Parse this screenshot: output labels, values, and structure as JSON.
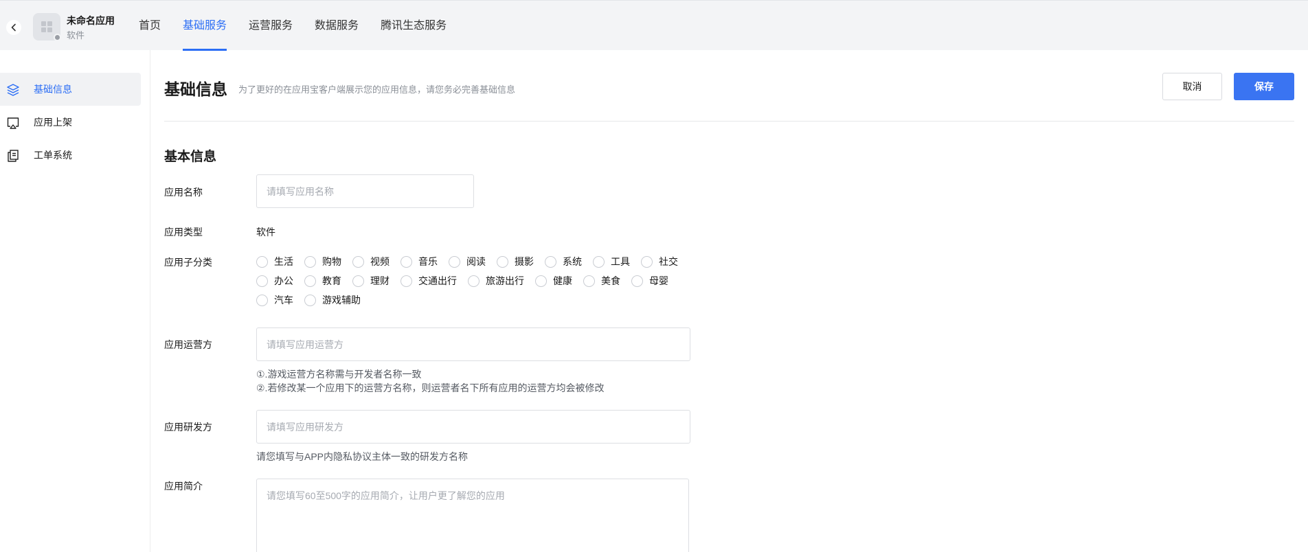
{
  "header": {
    "app_name": "未命名应用",
    "app_type": "软件",
    "tabs": [
      {
        "label": "首页"
      },
      {
        "label": "基础服务"
      },
      {
        "label": "运营服务"
      },
      {
        "label": "数据服务"
      },
      {
        "label": "腾讯生态服务"
      }
    ],
    "active_tab": "基础服务"
  },
  "sidebar": {
    "items": [
      {
        "label": "基础信息",
        "icon": "layers-icon"
      },
      {
        "label": "应用上架",
        "icon": "monitor-upload-icon"
      },
      {
        "label": "工单系统",
        "icon": "documents-icon"
      }
    ],
    "active": "基础信息"
  },
  "page": {
    "title": "基础信息",
    "description": "为了更好的在应用宝客户端展示您的应用信息，请您务必完善基础信息",
    "cancel_label": "取消",
    "save_label": "保存",
    "section_title": "基本信息"
  },
  "form": {
    "app_name": {
      "label": "应用名称",
      "placeholder": "请填写应用名称",
      "value": ""
    },
    "app_type": {
      "label": "应用类型",
      "value": "软件"
    },
    "subcategory": {
      "label": "应用子分类",
      "rows": [
        [
          "生活",
          "购物",
          "视频",
          "音乐",
          "阅读",
          "摄影",
          "系统",
          "工具",
          "社交"
        ],
        [
          "办公",
          "教育",
          "理财",
          "交通出行",
          "旅游出行",
          "健康",
          "美食",
          "母婴"
        ],
        [
          "汽车",
          "游戏辅助"
        ]
      ]
    },
    "operator": {
      "label": "应用运营方",
      "placeholder": "请填写应用运营方",
      "hint1": "①.游戏运营方名称需与开发者名称一致",
      "hint2": "②.若修改某一个应用下的运营方名称，则运营者名下所有应用的运营方均会被修改"
    },
    "developer": {
      "label": "应用研发方",
      "placeholder": "请填写应用研发方",
      "hint": "请您填写与APP内隐私协议主体一致的研发方名称"
    },
    "intro": {
      "label": "应用简介",
      "placeholder": "请您填写60至500字的应用简介，让用户更了解您的应用"
    }
  },
  "colors": {
    "accent": "#2c6ef5",
    "save_button": "#3a74f2",
    "topbar_bg": "#f3f4f6"
  }
}
